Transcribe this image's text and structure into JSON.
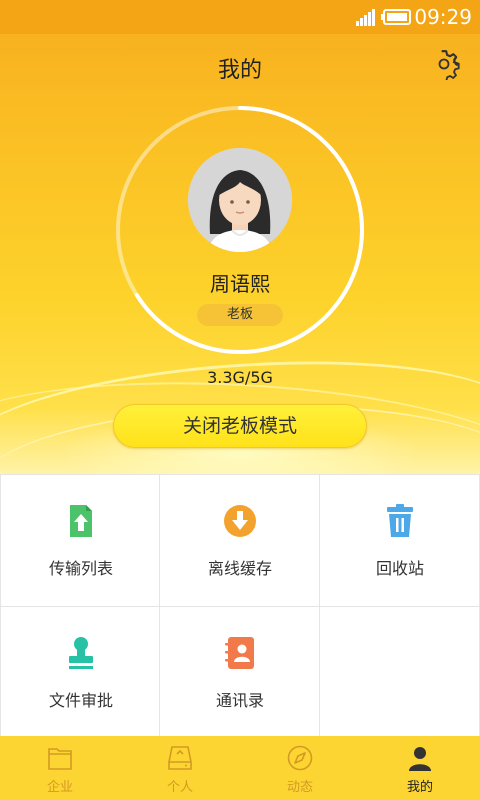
{
  "status_bar": {
    "time": "09:29"
  },
  "header": {
    "title": "我的"
  },
  "profile": {
    "name": "周语熙",
    "role": "老板",
    "storage_text": "3.3G/5G",
    "storage_used_fraction": 0.66,
    "mode_button_label": "关闭老板模式"
  },
  "grid": {
    "items": [
      {
        "label": "传输列表",
        "icon": "upload-file-icon",
        "color": "#4cc36a"
      },
      {
        "label": "离线缓存",
        "icon": "download-circle-icon",
        "color": "#f4a22e"
      },
      {
        "label": "回收站",
        "icon": "trash-icon",
        "color": "#4da8e8"
      },
      {
        "label": "文件审批",
        "icon": "stamp-icon",
        "color": "#27c1a6"
      },
      {
        "label": "通讯录",
        "icon": "contacts-book-icon",
        "color": "#f27a4a"
      }
    ]
  },
  "tabbar": {
    "tabs": [
      {
        "label": "企业",
        "icon": "folder-icon",
        "active": false
      },
      {
        "label": "个人",
        "icon": "drive-icon",
        "active": false
      },
      {
        "label": "动态",
        "icon": "compass-icon",
        "active": false
      },
      {
        "label": "我的",
        "icon": "person-icon",
        "active": true
      }
    ]
  }
}
